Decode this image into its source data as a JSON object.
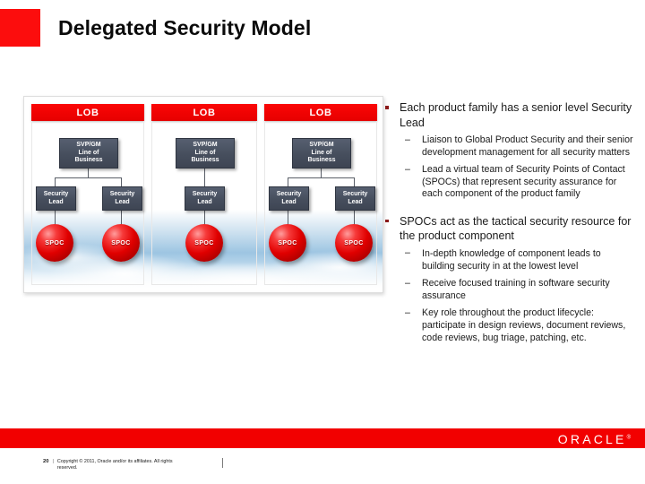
{
  "slide": {
    "title": "Delegated Security Model",
    "accent_color": "#fc0d0d"
  },
  "diagram": {
    "lob_label": "LOB",
    "svp_label": "SVP/GM Line of Business",
    "svp_line1": "SVP/GM",
    "svp_line2": "Line of",
    "svp_line3": "Business",
    "security_lead_line1": "Security",
    "security_lead_line2": "Lead",
    "spoc_label": "SPOC",
    "columns": [
      {
        "header": "LOB",
        "security_leads": 2,
        "spocs": 2
      },
      {
        "header": "LOB",
        "security_leads": 1,
        "spocs": 1
      },
      {
        "header": "LOB",
        "security_leads": 2,
        "spocs": 2
      }
    ],
    "colors": {
      "lob_header": "#f20000",
      "org_box": "#464e5d",
      "spoc_sphere": "#e00000",
      "connector_arrow": "#76818c"
    }
  },
  "bullets": [
    {
      "text": "Each product family has a senior level Security Lead",
      "sub": [
        "Liaison to Global Product Security and their senior development management for all security matters",
        "Lead a virtual team of Security Points of Contact (SPOCs) that represent security assurance for each component of the product family"
      ]
    },
    {
      "text": "SPOCs act as the tactical security resource for the product component",
      "sub": [
        "In-depth knowledge of component leads to building security in at the lowest level",
        "Receive focused training in software security assurance",
        "Key role throughout the product lifecycle: participate in design reviews, document reviews, code reviews, bug triage, patching, etc."
      ]
    }
  ],
  "footer": {
    "page_number": "20",
    "separator": "|",
    "copyright": "Copyright © 2011, Oracle and/or its affiliates. All rights reserved.",
    "brand": "ORACLE",
    "brand_mark": "®",
    "bar_color": "#f20000"
  }
}
